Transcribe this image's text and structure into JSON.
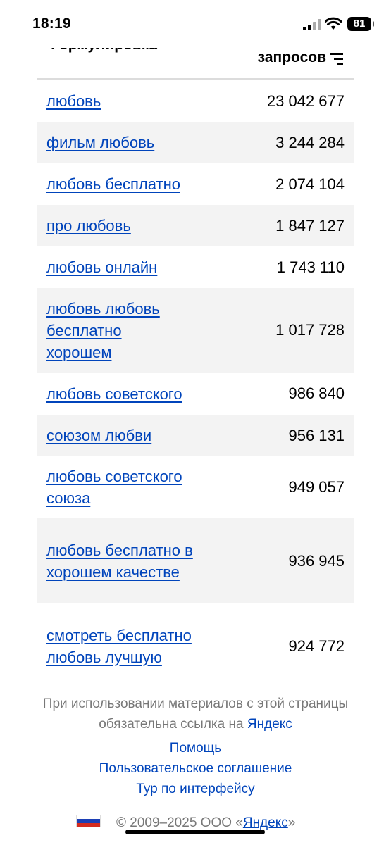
{
  "status_bar": {
    "time": "18:19",
    "battery": "81"
  },
  "table": {
    "col_phrase_header": "Формулировка",
    "col_count_header": "запросов",
    "rows": [
      {
        "phrase": "любовь",
        "count": "23 042 677"
      },
      {
        "phrase": "фильм любовь",
        "count": "3 244 284"
      },
      {
        "phrase": "любовь бесплатно",
        "count": "2 074 104"
      },
      {
        "phrase": "про любовь",
        "count": "1 847 127"
      },
      {
        "phrase": "любовь онлайн",
        "count": "1 743 110"
      },
      {
        "phrase": "любовь любовь бесплатно хорошем",
        "count": "1 017 728"
      },
      {
        "phrase": "любовь советского",
        "count": "986 840"
      },
      {
        "phrase": "союзом любви",
        "count": "956 131"
      },
      {
        "phrase": "любовь советского союза",
        "count": "949 057"
      },
      {
        "phrase": "любовь бесплатно в хорошем качестве",
        "count": "936 945"
      },
      {
        "phrase": "смотреть бесплатно любовь лучшую",
        "count": "924 772"
      }
    ]
  },
  "footer": {
    "note_line1": "При использовании материалов с этой страницы",
    "note_line2": "обязательна ссылка на",
    "note_link": "Яндекс",
    "help": "Помощь",
    "user_agreement": "Пользовательское соглашение",
    "interface_tour": "Тур по интерфейсу",
    "copyright_prefix": "© 2009–2025  ООО «",
    "copyright_link": "Яндекс",
    "copyright_suffix": "»"
  },
  "colors": {
    "link": "#0044bb",
    "alt_row": "#f3f3f3",
    "muted": "#777777"
  },
  "icons": [
    "signal-icon",
    "wifi-icon",
    "battery-icon",
    "sort-icon",
    "russia-flag-icon"
  ]
}
